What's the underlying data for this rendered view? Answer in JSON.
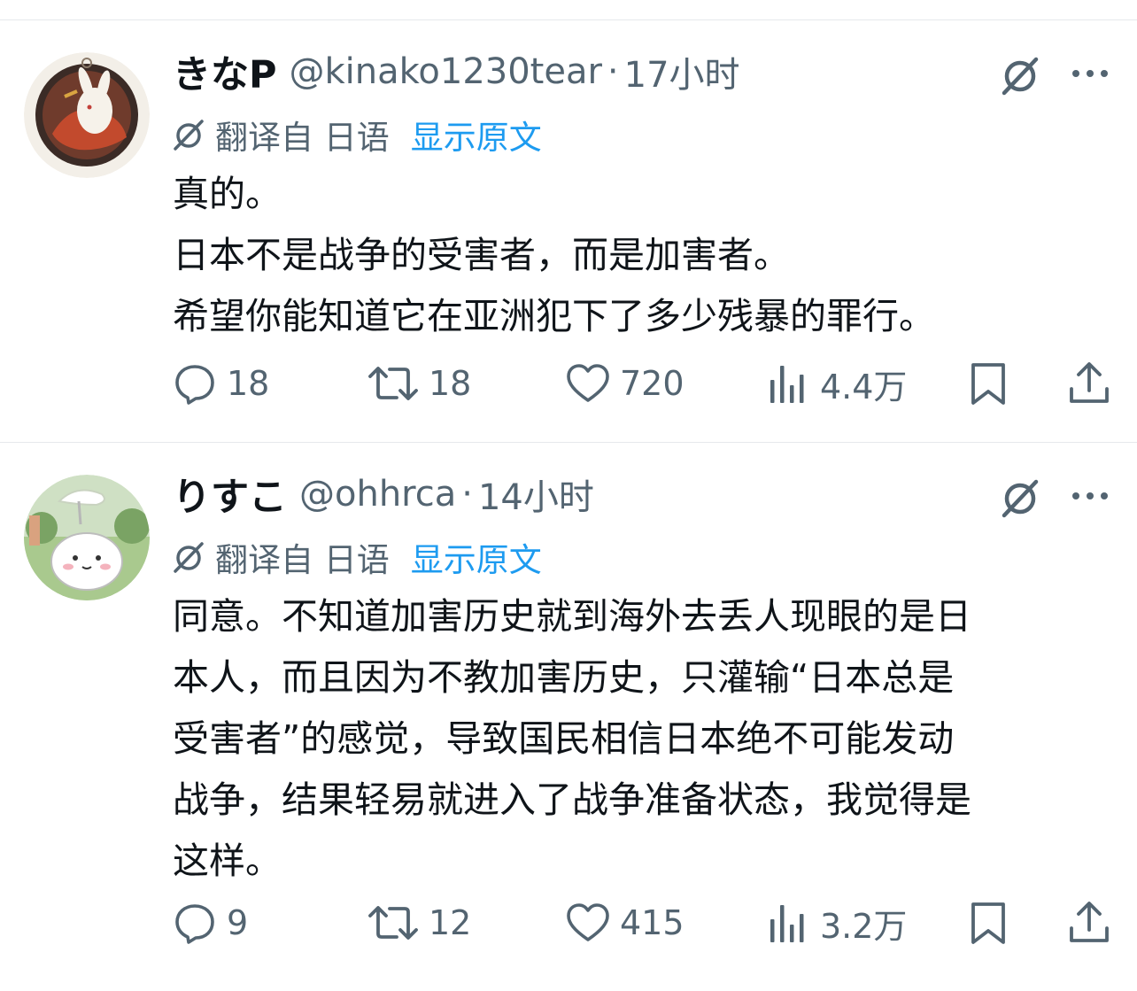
{
  "posts": [
    {
      "display_name": "きなP",
      "handle": "@kinako1230tear",
      "separator": "·",
      "time": "17小时",
      "translated_from": "翻译自 日语",
      "show_original": "显示原文",
      "text_lines": [
        "真的。",
        "日本不是战争的受害者，而是加害者。",
        "希望你能知道它在亚洲犯下了多少残暴的罪行。"
      ],
      "replies": "18",
      "reposts": "18",
      "likes": "720",
      "views": "4.4万"
    },
    {
      "display_name": "りすこ",
      "handle": "@ohhrca",
      "separator": "·",
      "time": "14小时",
      "translated_from": "翻译自 日语",
      "show_original": "显示原文",
      "text_lines": [
        "同意。不知道加害历史就到海外去丢人现眼的是日",
        "本人，而且因为不教加害历史，只灌输“日本总是",
        "受害者”的感觉，导致国民相信日本绝不可能发动",
        "战争，结果轻易就进入了战争准备状态，我觉得是",
        "这样。"
      ],
      "replies": "9",
      "reposts": "12",
      "likes": "415",
      "views": "3.2万"
    }
  ],
  "colors": {
    "text_primary": "#0f1419",
    "text_secondary": "#536471",
    "link": "#1d9bf0",
    "divider": "#e6e9ec"
  },
  "icons": {
    "reply": "speech-bubble-icon",
    "repost": "repost-arrows-icon",
    "like": "heart-icon",
    "views": "bar-chart-icon",
    "bookmark": "bookmark-icon",
    "share": "share-upload-icon",
    "grok": "grok-slash-circle-icon",
    "more": "more-dots-icon",
    "translate": "translate-slash-circle-icon"
  }
}
